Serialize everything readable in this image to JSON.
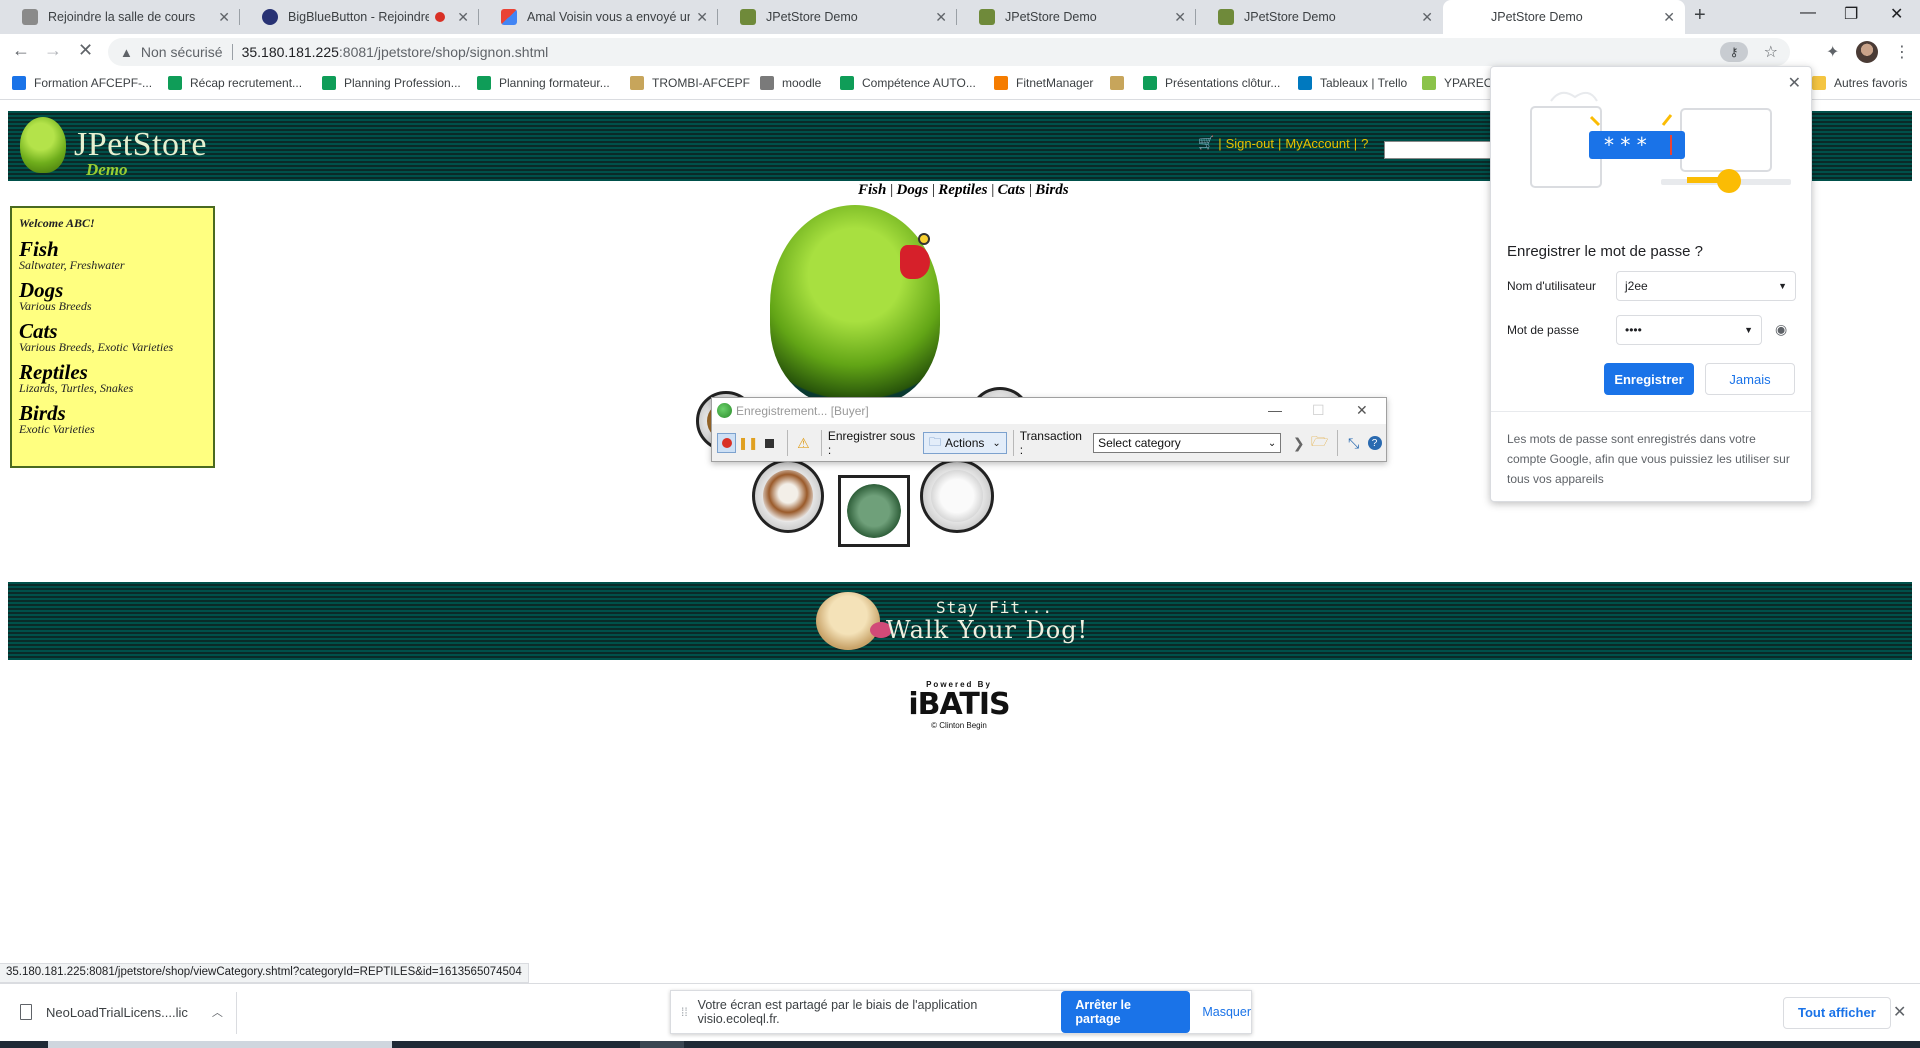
{
  "browser": {
    "tabs": [
      {
        "title": "Rejoindre la salle de cours",
        "fav_color": "#8a8a8a"
      },
      {
        "title": "BigBlueButton - Rejoindre la",
        "fav_color": "#283274",
        "recording": true
      },
      {
        "title": "Amal Voisin vous a envoyé un m",
        "fav_color": "#ea4335"
      },
      {
        "title": "JPetStore Demo",
        "fav_color": "#6f8a3a"
      },
      {
        "title": "JPetStore Demo",
        "fav_color": "#6f8a3a"
      },
      {
        "title": "JPetStore Demo",
        "fav_color": "#6f8a3a"
      },
      {
        "title": "JPetStore Demo",
        "fav_color": "#ffffff",
        "active": true
      }
    ],
    "close_glyph": "✕",
    "new_tab_glyph": "+",
    "window_controls": {
      "minimize": "—",
      "maximize": "❐",
      "close": "✕"
    },
    "address": {
      "security_label": "Non sécurisé",
      "host": "35.180.181.225",
      "path": ":8081/jpetstore/shop/signon.shtml"
    },
    "nav": {
      "back": "←",
      "forward": "→",
      "reload": "✕"
    },
    "icons": {
      "key": "key-icon",
      "star": "star-icon",
      "extensions": "puzzle-icon",
      "menu": "kebab-menu-icon"
    },
    "bookmarks": [
      {
        "label": "Formation AFCEPF-...",
        "color": "#1a73e8"
      },
      {
        "label": "Récap recrutement...",
        "color": "#0f9d58"
      },
      {
        "label": "Planning Profession...",
        "color": "#0f9d58"
      },
      {
        "label": "Planning formateur...",
        "color": "#0f9d58"
      },
      {
        "label": "TROMBI-AFCEPF",
        "color": "#c7a55b"
      },
      {
        "label": "moodle",
        "color": "#7a7a7a"
      },
      {
        "label": "Compétence AUTO...",
        "color": "#0f9d58"
      },
      {
        "label": "FitnetManager",
        "color": "#f57c00"
      },
      {
        "label": "",
        "color": "#c7a55b"
      },
      {
        "label": "Présentations clôtur...",
        "color": "#0f9d58"
      },
      {
        "label": "Tableaux | Trello",
        "color": "#0079bf"
      },
      {
        "label": "YPAREO",
        "color": "#8bc34a"
      }
    ],
    "other_bookmarks": "Autres favoris"
  },
  "jpetstore": {
    "logo_title": "JPetStore",
    "logo_sub": "Demo",
    "header_links": {
      "signout": "Sign-out",
      "myaccount": "MyAccount",
      "help": "?"
    },
    "quick_links": [
      "Fish",
      "Dogs",
      "Reptiles",
      "Cats",
      "Birds"
    ],
    "welcome": "Welcome ABC!",
    "categories": [
      {
        "name": "Fish",
        "desc": "Saltwater, Freshwater"
      },
      {
        "name": "Dogs",
        "desc": "Various Breeds"
      },
      {
        "name": "Cats",
        "desc": "Various Breeds, Exotic Varieties"
      },
      {
        "name": "Reptiles",
        "desc": "Lizards, Turtles, Snakes"
      },
      {
        "name": "Birds",
        "desc": "Exotic Varieties"
      }
    ],
    "banner": {
      "line1": "Stay Fit...",
      "line2": "Walk Your Dog!"
    },
    "powered": {
      "top": "Powered By",
      "logo": "iBATIS",
      "credit": "© Clinton Begin"
    }
  },
  "recorder": {
    "title": "Enregistrement... [Buyer]",
    "save_as_label": "Enregistrer sous :",
    "actions_label": "Actions",
    "transaction_label": "Transaction :",
    "category_value": "Select category"
  },
  "password_popup": {
    "title": "Enregistrer le mot de passe ?",
    "username_label": "Nom d'utilisateur",
    "username_value": "j2ee",
    "password_label": "Mot de passe",
    "password_value": "••••",
    "save_button": "Enregistrer",
    "never_button": "Jamais",
    "footer": "Les mots de passe sont enregistrés dans votre compte Google, afin que vous puissiez les utiliser sur tous vos appareils",
    "illustration_text": "* * *"
  },
  "status_url": "35.180.181.225:8081/jpetstore/shop/viewCategory.shtml?categoryId=REPTILES&id=1613565074504",
  "download_bar": {
    "file_name": "NeoLoadTrialLicens....lic",
    "share_message": "Votre écran est partagé par le biais de l'application visio.ecoleql.fr.",
    "stop_sharing": "Arrêter le partage",
    "hide": "Masquer",
    "show_all": "Tout afficher"
  }
}
